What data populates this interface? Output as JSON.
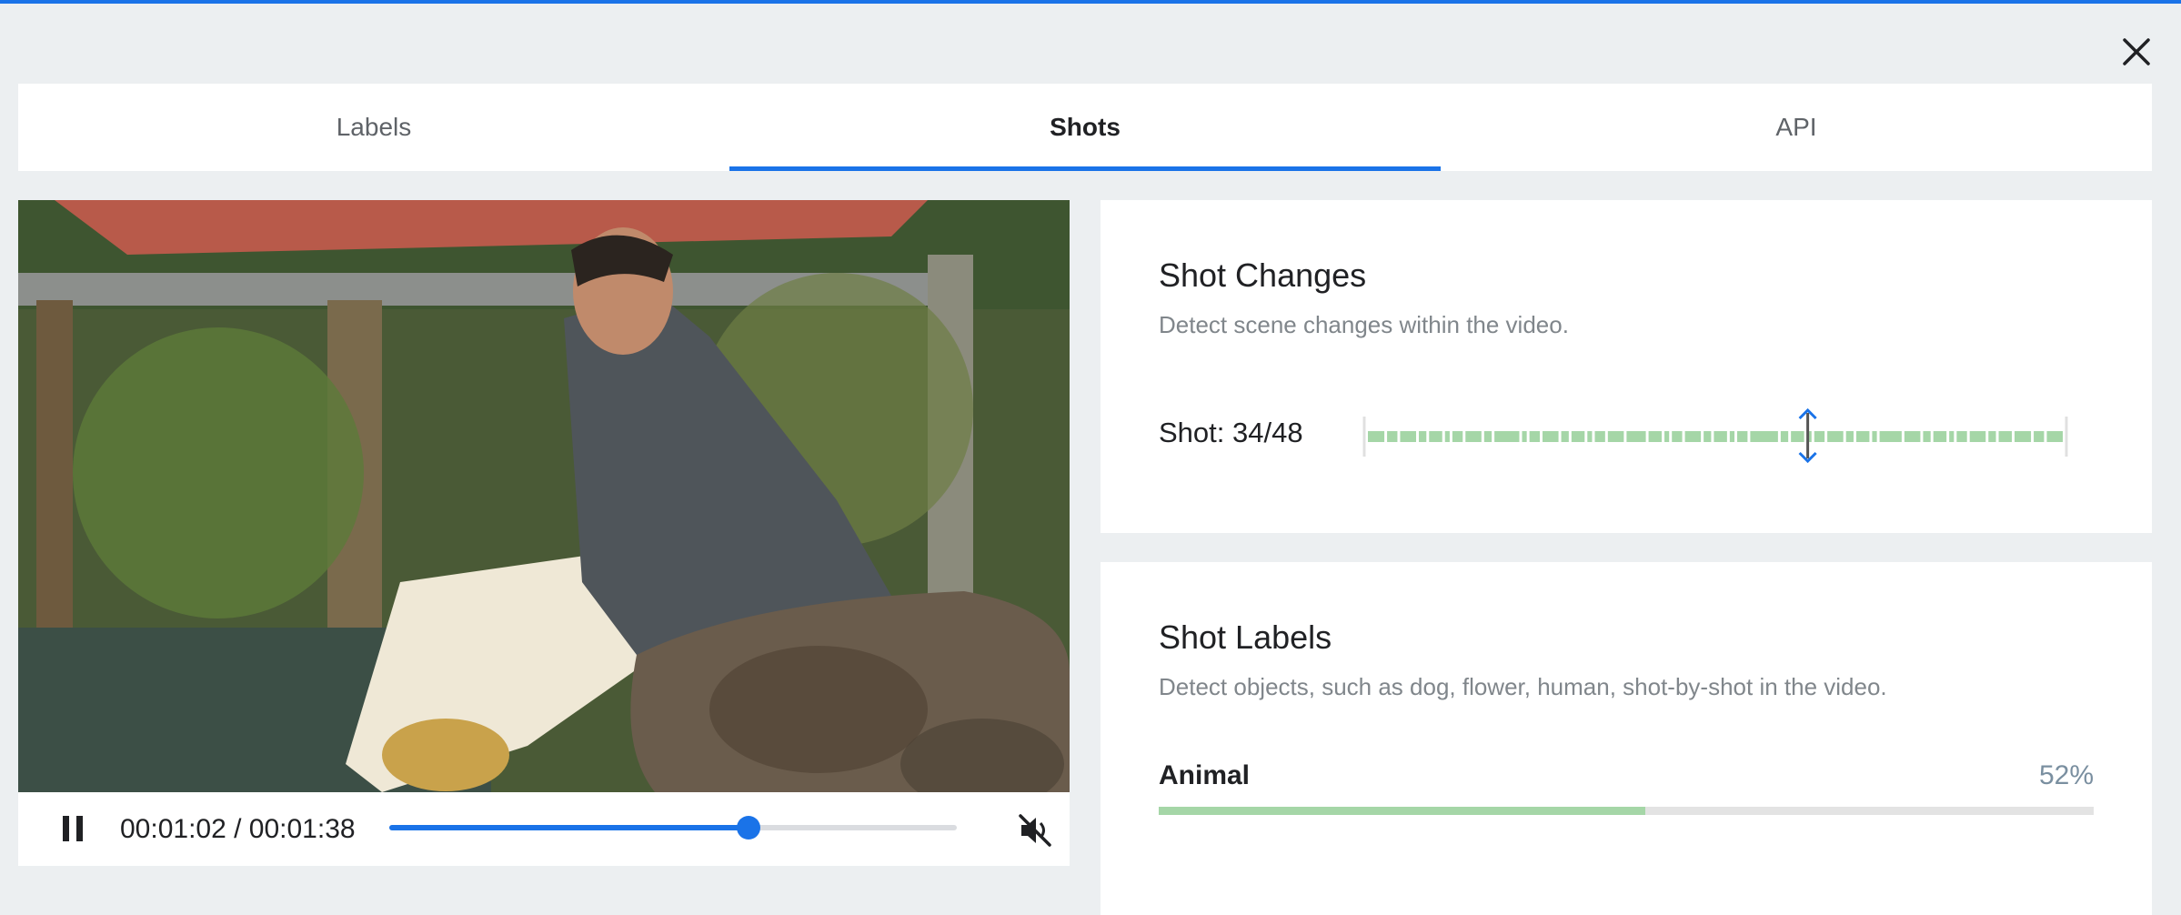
{
  "tabs": [
    {
      "label": "Labels",
      "active": false
    },
    {
      "label": "Shots",
      "active": true
    },
    {
      "label": "API",
      "active": false
    }
  ],
  "icons": {
    "close": "close-icon",
    "pause": "pause-icon",
    "mute": "volume-off-icon",
    "marker": "chevron-up-down-icon"
  },
  "colors": {
    "accent": "#1a73e8",
    "shot_segment": "#a5d6a7",
    "label_bar_fill": "#a5d6a7"
  },
  "player": {
    "time_readout": "00:01:02 / 00:01:38",
    "progress": 0.633
  },
  "shot_changes": {
    "title": "Shot Changes",
    "description": "Detect scene changes within the video.",
    "counter": "Shot: 34/48",
    "current_shot": 34,
    "total_shots": 48,
    "marker_position": 0.633
  },
  "shot_labels": {
    "title": "Shot Labels",
    "description": "Detect objects, such as dog, flower, human, shot-by-shot in the video.",
    "items": [
      {
        "name": "Animal",
        "percent_text": "52%",
        "value": 0.52
      }
    ]
  }
}
